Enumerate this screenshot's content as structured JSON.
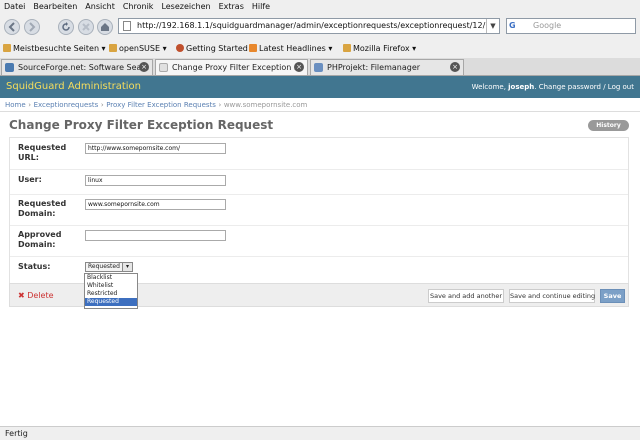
{
  "menu": [
    "Datei",
    "Bearbeiten",
    "Ansicht",
    "Chronik",
    "Lesezeichen",
    "Extras",
    "Hilfe"
  ],
  "navbar": {
    "url": "http://192.168.1.1/squidguardmanager/admin/exceptionrequests/exceptionrequest/12/",
    "search_engine": "G",
    "search_placeholder": "Google"
  },
  "bookmarks": [
    {
      "label": "Meistbesuchte Seiten ▾",
      "icon": "folder-icon",
      "color": "#d9a441"
    },
    {
      "label": "openSUSE ▾",
      "icon": "folder-icon",
      "color": "#d9a441"
    },
    {
      "label": "Getting Started",
      "icon": "firefox-icon",
      "color": "#c0502d"
    },
    {
      "label": "Latest Headlines ▾",
      "icon": "rss-icon",
      "color": "#e8882d"
    },
    {
      "label": "Mozilla Firefox ▾",
      "icon": "folder-icon",
      "color": "#d9a441"
    }
  ],
  "tabs": [
    {
      "label": "SourceForge.net: Software Sea...",
      "active": false,
      "icon_color": "#4a7ab0"
    },
    {
      "label": "Change Proxy Filter Exception ...",
      "active": true,
      "icon_color": "#e0e0e0"
    },
    {
      "label": "PHProjekt: Filemanager",
      "active": false,
      "icon_color": "#6a8fc0"
    }
  ],
  "header": {
    "brand": "SquidGuard Administration",
    "welcome": "Welcome,",
    "username": "joseph",
    "user_links": ". Change password / Log out"
  },
  "breadcrumbs": [
    "Home",
    "Exceptionrequests",
    "Proxy Filter Exception Requests",
    "www.somepornsite.com"
  ],
  "page_title": "Change Proxy Filter Exception Request",
  "history_label": "History",
  "form": {
    "requested_url_label": "Requested URL:",
    "requested_url_value": "http://www.somepornsite.com/",
    "user_label": "User:",
    "user_value": "linux",
    "requested_domain_label": "Requested Domain:",
    "requested_domain_value": "www.somepornsite.com",
    "approved_domain_label": "Approved Domain:",
    "approved_domain_value": "",
    "status_label": "Status:",
    "status_value": "Requested",
    "status_options": [
      "Blacklist",
      "Whitelist",
      "Restricted",
      "Requested"
    ]
  },
  "actions": {
    "delete": "Delete",
    "save_add_another": "Save and add another",
    "save_continue": "Save and continue editing",
    "save": "Save"
  },
  "statusbar": "Fertig",
  "colors": {
    "header_bg": "#417690",
    "brand": "#f5dd5d",
    "link": "#5b80b2",
    "delete": "#cc3333",
    "save_button": "#7ca0c7"
  }
}
